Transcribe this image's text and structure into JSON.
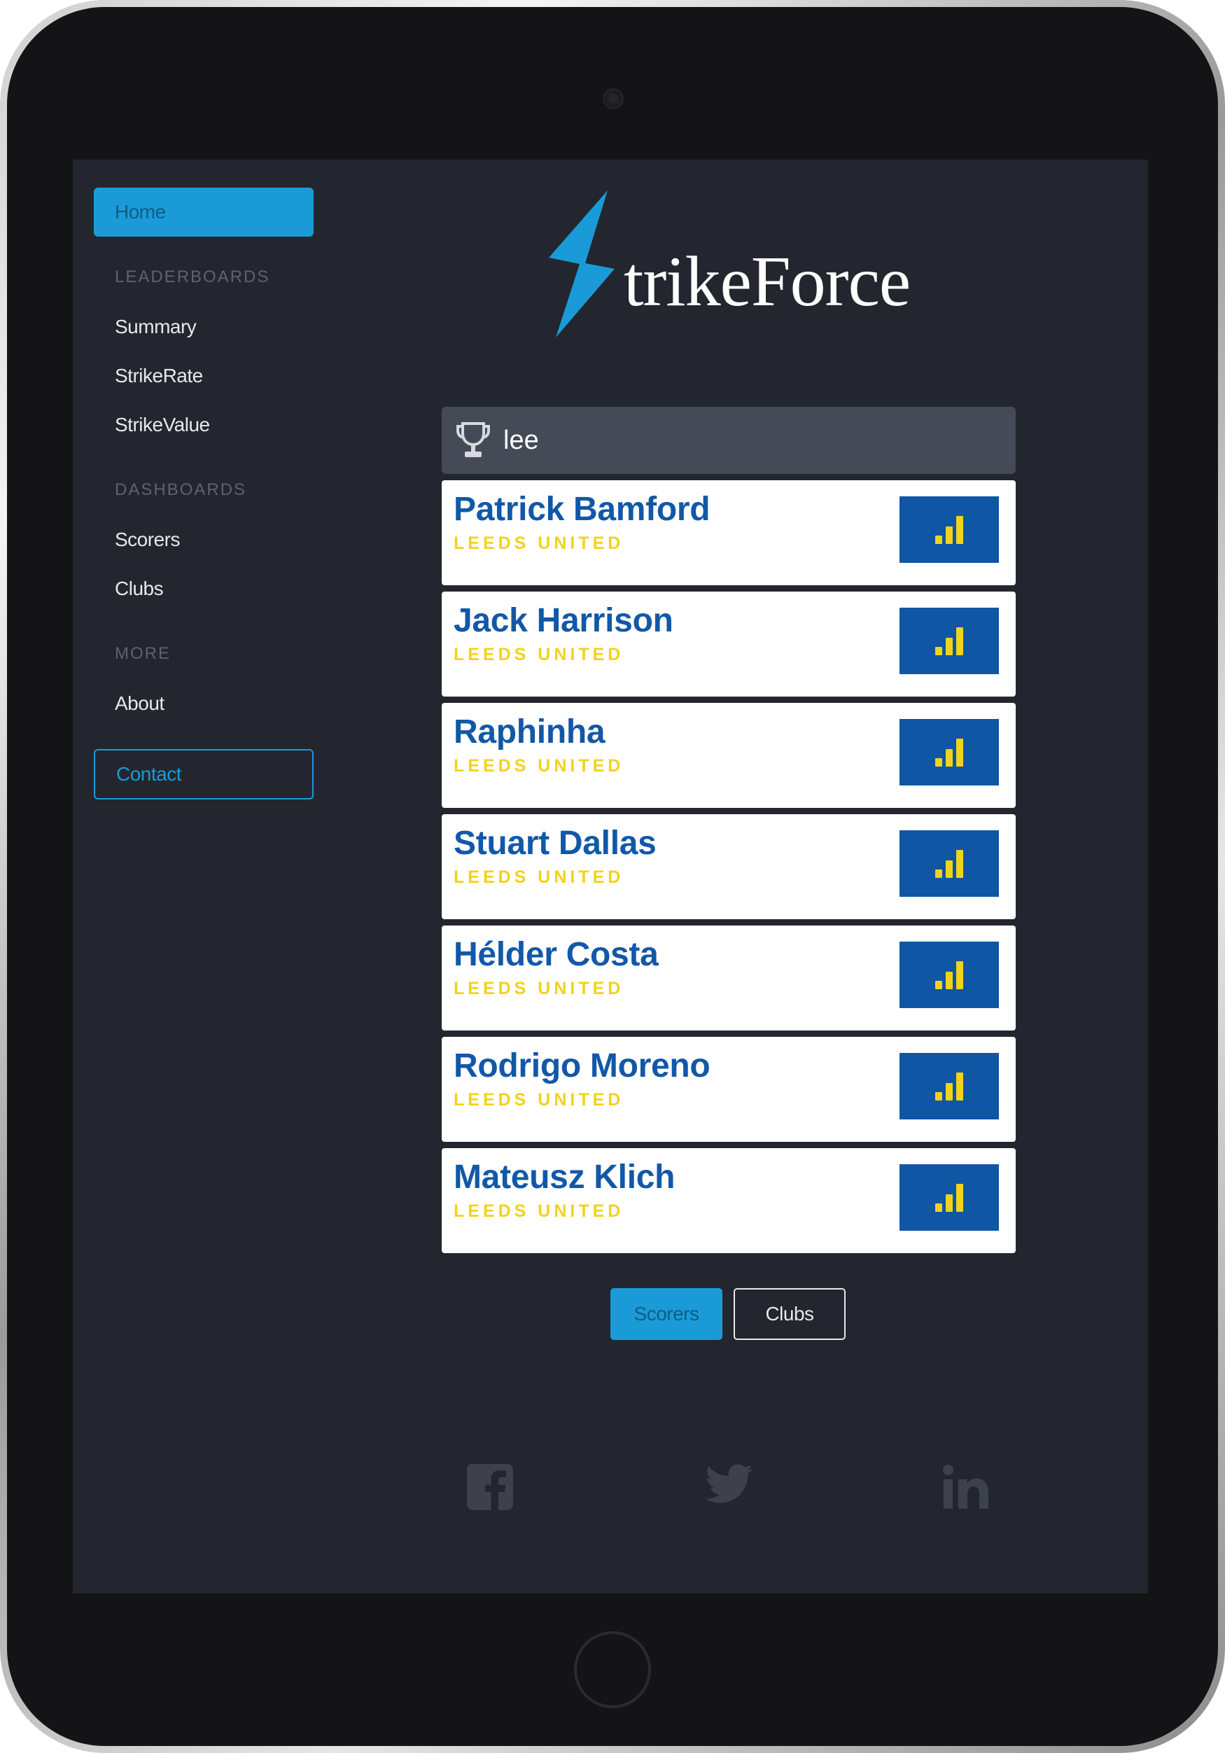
{
  "sidebar": {
    "home": "Home",
    "sections": [
      {
        "title": "LEADERBOARDS",
        "items": [
          "Summary",
          "StrikeRate",
          "StrikeValue"
        ]
      },
      {
        "title": "DASHBOARDS",
        "items": [
          "Scorers",
          "Clubs"
        ]
      },
      {
        "title": "MORE",
        "items": [
          "About"
        ]
      }
    ],
    "contact": "Contact"
  },
  "logo": {
    "text": "trikeForce"
  },
  "search": {
    "term": "lee",
    "icon": "trophy-icon"
  },
  "results": [
    {
      "name": "Patrick Bamford",
      "club": "LEEDS UNITED"
    },
    {
      "name": "Jack Harrison",
      "club": "LEEDS UNITED"
    },
    {
      "name": "Raphinha",
      "club": "LEEDS UNITED"
    },
    {
      "name": "Stuart Dallas",
      "club": "LEEDS UNITED"
    },
    {
      "name": "Hélder Costa",
      "club": "LEEDS UNITED"
    },
    {
      "name": "Rodrigo Moreno",
      "club": "LEEDS UNITED"
    },
    {
      "name": "Mateusz Klich",
      "club": "LEEDS UNITED"
    }
  ],
  "toggle": {
    "scorers": "Scorers",
    "clubs": "Clubs"
  },
  "social": [
    "facebook-icon",
    "twitter-icon",
    "linkedin-icon"
  ],
  "colors": {
    "accent": "#1a9bd7",
    "background": "#23262e",
    "player_name": "#1258a8",
    "club_name": "#f2d31b",
    "stats_button": "#0f56a4"
  }
}
